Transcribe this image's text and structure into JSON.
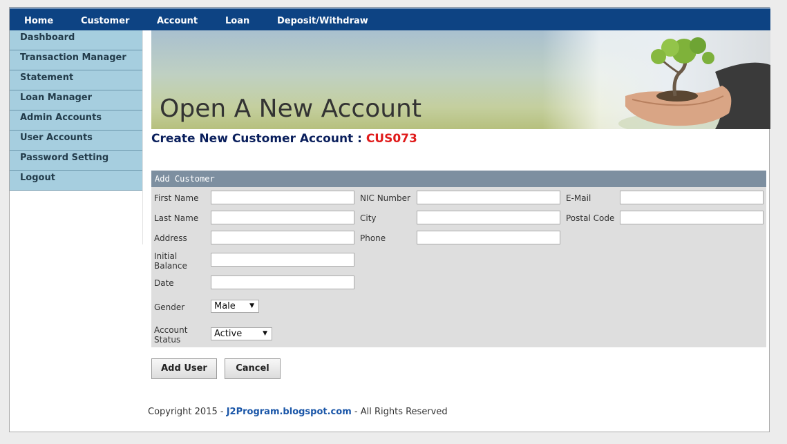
{
  "topnav": [
    "Home",
    "Customer",
    "Account",
    "Loan",
    "Deposit/Withdraw"
  ],
  "sidebar": [
    "Dashboard",
    "Transaction Manager",
    "Statement",
    "Loan Manager",
    "Admin Accounts",
    "User Accounts",
    "Password Setting",
    "Logout"
  ],
  "banner": {
    "title": "Open A New Account"
  },
  "heading": {
    "text": "Create New Customer Account : ",
    "code": "CUS073"
  },
  "form": {
    "header": "Add Customer",
    "labels": {
      "first_name": "First Name",
      "last_name": "Last Name",
      "address": "Address",
      "initial_balance_1": "Initial",
      "initial_balance_2": "Balance",
      "date": "Date",
      "gender": "Gender",
      "account_status_1": "Account",
      "account_status_2": "Status",
      "nic": "NIC Number",
      "city": "City",
      "phone": "Phone",
      "email": "E-Mail",
      "postal": "Postal Code"
    },
    "gender_value": "Male",
    "status_value": "Active"
  },
  "buttons": {
    "add": "Add User",
    "cancel": "Cancel"
  },
  "footer": {
    "prefix": "Copyright 2015 - ",
    "link": "J2Program.blogspot.com",
    "suffix": " - All Rights Reserved"
  },
  "colors": {
    "nav": "#0d4383",
    "sidebar": "#a6cedf",
    "code": "#e01b1b",
    "form_header": "#7d8fa0"
  }
}
